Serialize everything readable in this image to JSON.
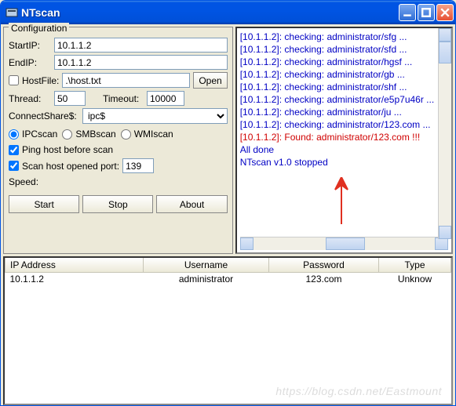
{
  "title": "NTscan",
  "config": {
    "legend": "Configuration",
    "startip_label": "StartIP:",
    "startip_value": "10.1.1.2",
    "endip_label": "EndIP:",
    "endip_value": "10.1.1.2",
    "hostfile_label": "HostFile:",
    "hostfile_value": ".\\host.txt",
    "open_btn": "Open",
    "thread_label": "Thread:",
    "thread_value": "50",
    "timeout_label": "Timeout:",
    "timeout_value": "10000",
    "connect_label": "ConnectShare$:",
    "connect_value": "ipc$",
    "scan_ipc": "IPCscan",
    "scan_smb": "SMBscan",
    "scan_wmi": "WMIscan",
    "ping_label": "Ping host before scan",
    "port_label": "Scan host opened port:",
    "port_value": "139",
    "speed_label": "Speed:",
    "start_btn": "Start",
    "stop_btn": "Stop",
    "about_btn": "About"
  },
  "log": {
    "lines": [
      {
        "cls": "blue",
        "text": "[10.1.1.2]: checking: administrator/sfg ..."
      },
      {
        "cls": "blue",
        "text": "[10.1.1.2]: checking: administrator/sfd ..."
      },
      {
        "cls": "blue",
        "text": "[10.1.1.2]: checking: administrator/hgsf ..."
      },
      {
        "cls": "blue",
        "text": "[10.1.1.2]: checking: administrator/gb ..."
      },
      {
        "cls": "blue",
        "text": "[10.1.1.2]: checking: administrator/shf ..."
      },
      {
        "cls": "blue",
        "text": "[10.1.1.2]: checking: administrator/e5p7u46r ..."
      },
      {
        "cls": "blue",
        "text": "[10.1.1.2]: checking: administrator/ju ..."
      },
      {
        "cls": "blue",
        "text": "[10.1.1.2]: checking: administrator/123.com ..."
      },
      {
        "cls": "red",
        "text": "[10.1.1.2]: Found: administrator/123.com !!!"
      },
      {
        "cls": "blue",
        "text": ""
      },
      {
        "cls": "blue",
        "text": "All done"
      },
      {
        "cls": "blue",
        "text": "NTscan v1.0 stopped"
      }
    ]
  },
  "table": {
    "cols": [
      "IP Address",
      "Username",
      "Password",
      "Type"
    ],
    "rows": [
      {
        "ip": "10.1.1.2",
        "user": "administrator",
        "pass": "123.com",
        "type": "Unknow"
      }
    ]
  },
  "watermark": "https://blog.csdn.net/Eastmount"
}
